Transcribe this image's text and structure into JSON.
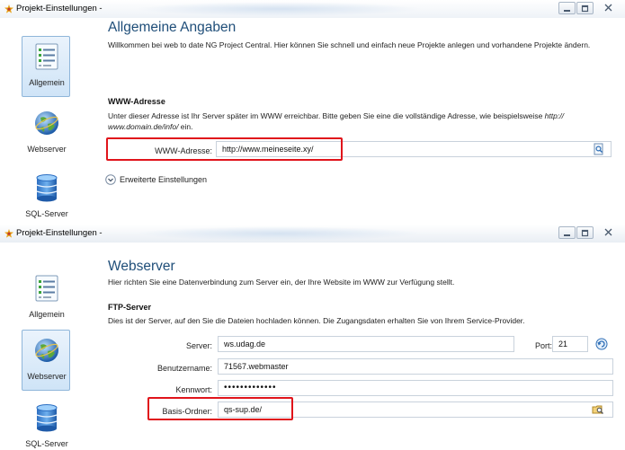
{
  "window1": {
    "title": "Projekt-Einstellungen -",
    "sidebar": [
      {
        "label": "Allgemein",
        "icon": "checklist-icon"
      },
      {
        "label": "Webserver",
        "icon": "globe-icon"
      },
      {
        "label": "SQL-Server",
        "icon": "database-icon"
      }
    ],
    "page_title": "Allgemeine Angaben",
    "intro": "Willkommen bei web to date NG Project Central. Hier können Sie schnell und einfach neue Projekte anlegen und vorhandene Projekte ändern.",
    "section_title": "WWW-Adresse",
    "section_desc_prefix": "Unter dieser Adresse ist Ihr Server später im WWW erreichbar. Bitte geben Sie eine die vollständige Adresse, wie beispielsweise ",
    "section_desc_example1": "http://",
    "section_desc_example2": "www.domain.de/info/",
    "section_desc_suffix": " ein.",
    "www_label": "WWW-Adresse:",
    "www_value": "http://www.meineseite.xy/",
    "advanced_label": "Erweiterte Einstellungen"
  },
  "window2": {
    "title": "Projekt-Einstellungen -",
    "sidebar": [
      {
        "label": "Allgemein",
        "icon": "checklist-icon"
      },
      {
        "label": "Webserver",
        "icon": "globe-icon"
      },
      {
        "label": "SQL-Server",
        "icon": "database-icon"
      }
    ],
    "page_title": "Webserver",
    "intro": "Hier richten Sie eine Datenverbindung zum Server ein, der Ihre Website im WWW zur Verfügung stellt.",
    "section_title": "FTP-Server",
    "section_desc": "Dies ist der Server, auf den Sie die Dateien hochladen können. Die Zugangsdaten erhalten Sie von Ihrem Service-Provider.",
    "server_label": "Server:",
    "server_value": "ws.udag.de",
    "port_label": "Port:",
    "port_value": "21",
    "username_label": "Benutzername:",
    "username_value": "71567.webmaster",
    "password_label": "Kennwort:",
    "password_value": "•••••••••••••",
    "basedir_label": "Basis-Ordner:",
    "basedir_value": "qs-sup.de/"
  },
  "colors": {
    "title_blue": "#1f4e79",
    "highlight_red": "#e0141b",
    "nav_active": "#cfe4f7"
  }
}
